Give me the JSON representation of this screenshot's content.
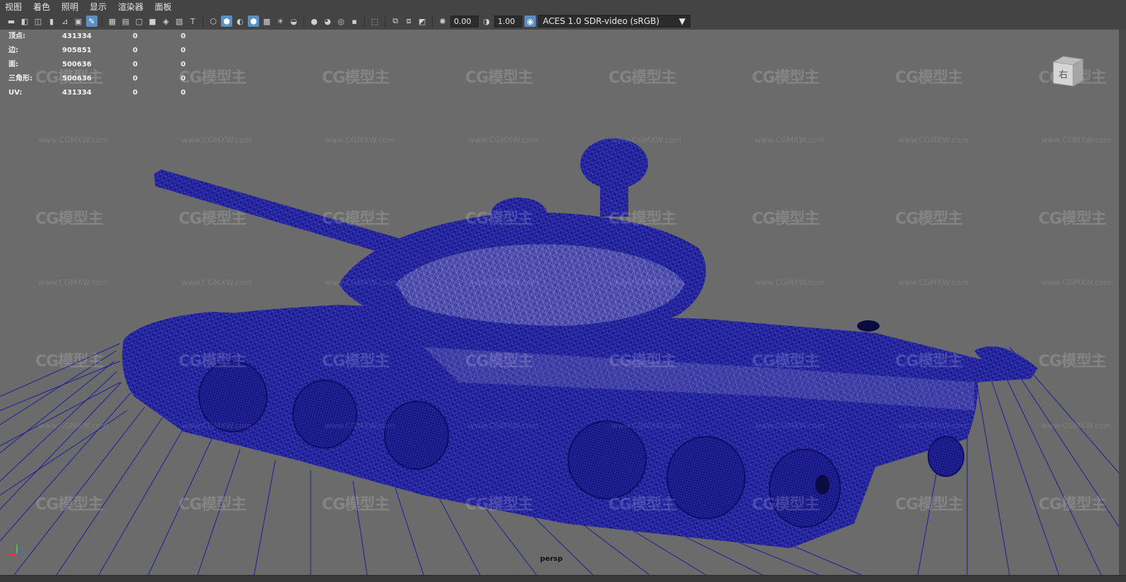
{
  "menu": [
    "视图",
    "着色",
    "照明",
    "显示",
    "渲染器",
    "面板"
  ],
  "toolbar": {
    "exposure": "0.00",
    "gamma": "1.00",
    "color_space": "ACES 1.0 SDR-video (sRGB)"
  },
  "hud": {
    "rows": [
      {
        "label": "顶点:",
        "v1": "431334",
        "v2": "0",
        "v3": "0"
      },
      {
        "label": "边:",
        "v1": "905851",
        "v2": "0",
        "v3": "0"
      },
      {
        "label": "面:",
        "v1": "500636",
        "v2": "0",
        "v3": "0"
      },
      {
        "label": "三角形:",
        "v1": "500636",
        "v2": "0",
        "v3": "0"
      },
      {
        "label": "UV:",
        "v1": "431334",
        "v2": "0",
        "v3": "0"
      }
    ]
  },
  "viewport": {
    "camera": "persp",
    "viewcube_label": "右",
    "watermark_logo": "CG模型主",
    "watermark_url": "www.CGMXW.com",
    "wire_color": "#1a1aa0",
    "background_color": "#6b6b6b"
  }
}
